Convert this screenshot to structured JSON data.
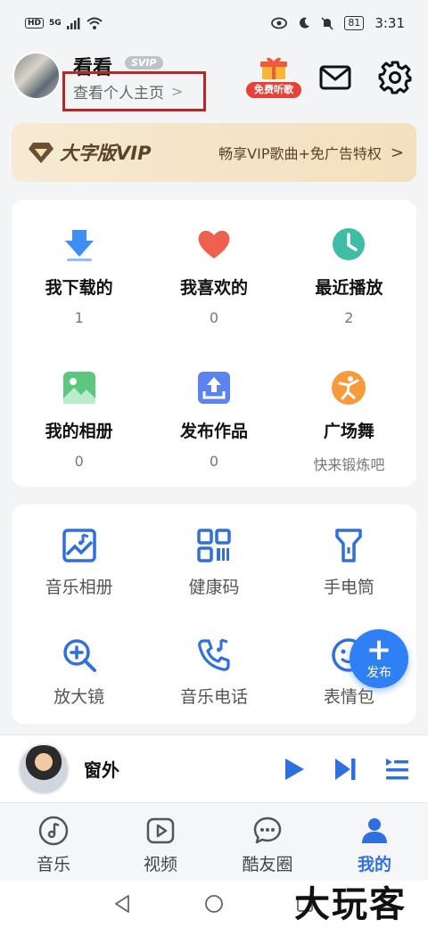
{
  "status_bar": {
    "time": "3:31",
    "battery": "81",
    "network": "5G",
    "hd": "HD"
  },
  "header": {
    "username": "看看",
    "badge": "SVIP",
    "profile_link": "查看个人主页",
    "gift_badge": "免费听歌"
  },
  "vip_banner": {
    "title": "大字版VIP",
    "desc": "畅享VIP歌曲+免广告特权"
  },
  "quick_grid": [
    {
      "label": "我下载的",
      "sub": "1",
      "icon": "download-icon",
      "color": "#3e8ef7"
    },
    {
      "label": "我喜欢的",
      "sub": "0",
      "icon": "heart-icon",
      "color": "#f0604f"
    },
    {
      "label": "最近播放",
      "sub": "2",
      "icon": "clock-icon",
      "color": "#41bca7"
    },
    {
      "label": "我的相册",
      "sub": "0",
      "icon": "image-icon",
      "color": "#5cc77e"
    },
    {
      "label": "发布作品",
      "sub": "0",
      "icon": "upload-icon",
      "color": "#5b84ef"
    },
    {
      "label": "广场舞",
      "sub": "快来锻炼吧",
      "icon": "dancer-icon",
      "color": "#f79a3c"
    }
  ],
  "tools": [
    {
      "label": "音乐相册",
      "icon": "photo-album-icon"
    },
    {
      "label": "健康码",
      "icon": "qr-code-icon"
    },
    {
      "label": "手电筒",
      "icon": "flashlight-icon"
    },
    {
      "label": "放大镜",
      "icon": "magnifier-icon"
    },
    {
      "label": "音乐电话",
      "icon": "music-phone-icon"
    },
    {
      "label": "表情包",
      "icon": "emoji-icon"
    }
  ],
  "fab": {
    "label": "发布"
  },
  "player": {
    "song": "窗外"
  },
  "tabs": [
    {
      "label": "音乐",
      "icon": "music-note-icon",
      "active": false
    },
    {
      "label": "视频",
      "icon": "video-play-icon",
      "active": false
    },
    {
      "label": "酷友圈",
      "icon": "chat-bubble-icon",
      "active": false
    },
    {
      "label": "我的",
      "icon": "person-icon",
      "active": true
    }
  ],
  "watermark": "大玩客",
  "colors": {
    "accent": "#2f7ff5",
    "tab_active": "#2f6fe0",
    "gift_red": "#e8413a",
    "highlight_box": "#b5282a"
  }
}
